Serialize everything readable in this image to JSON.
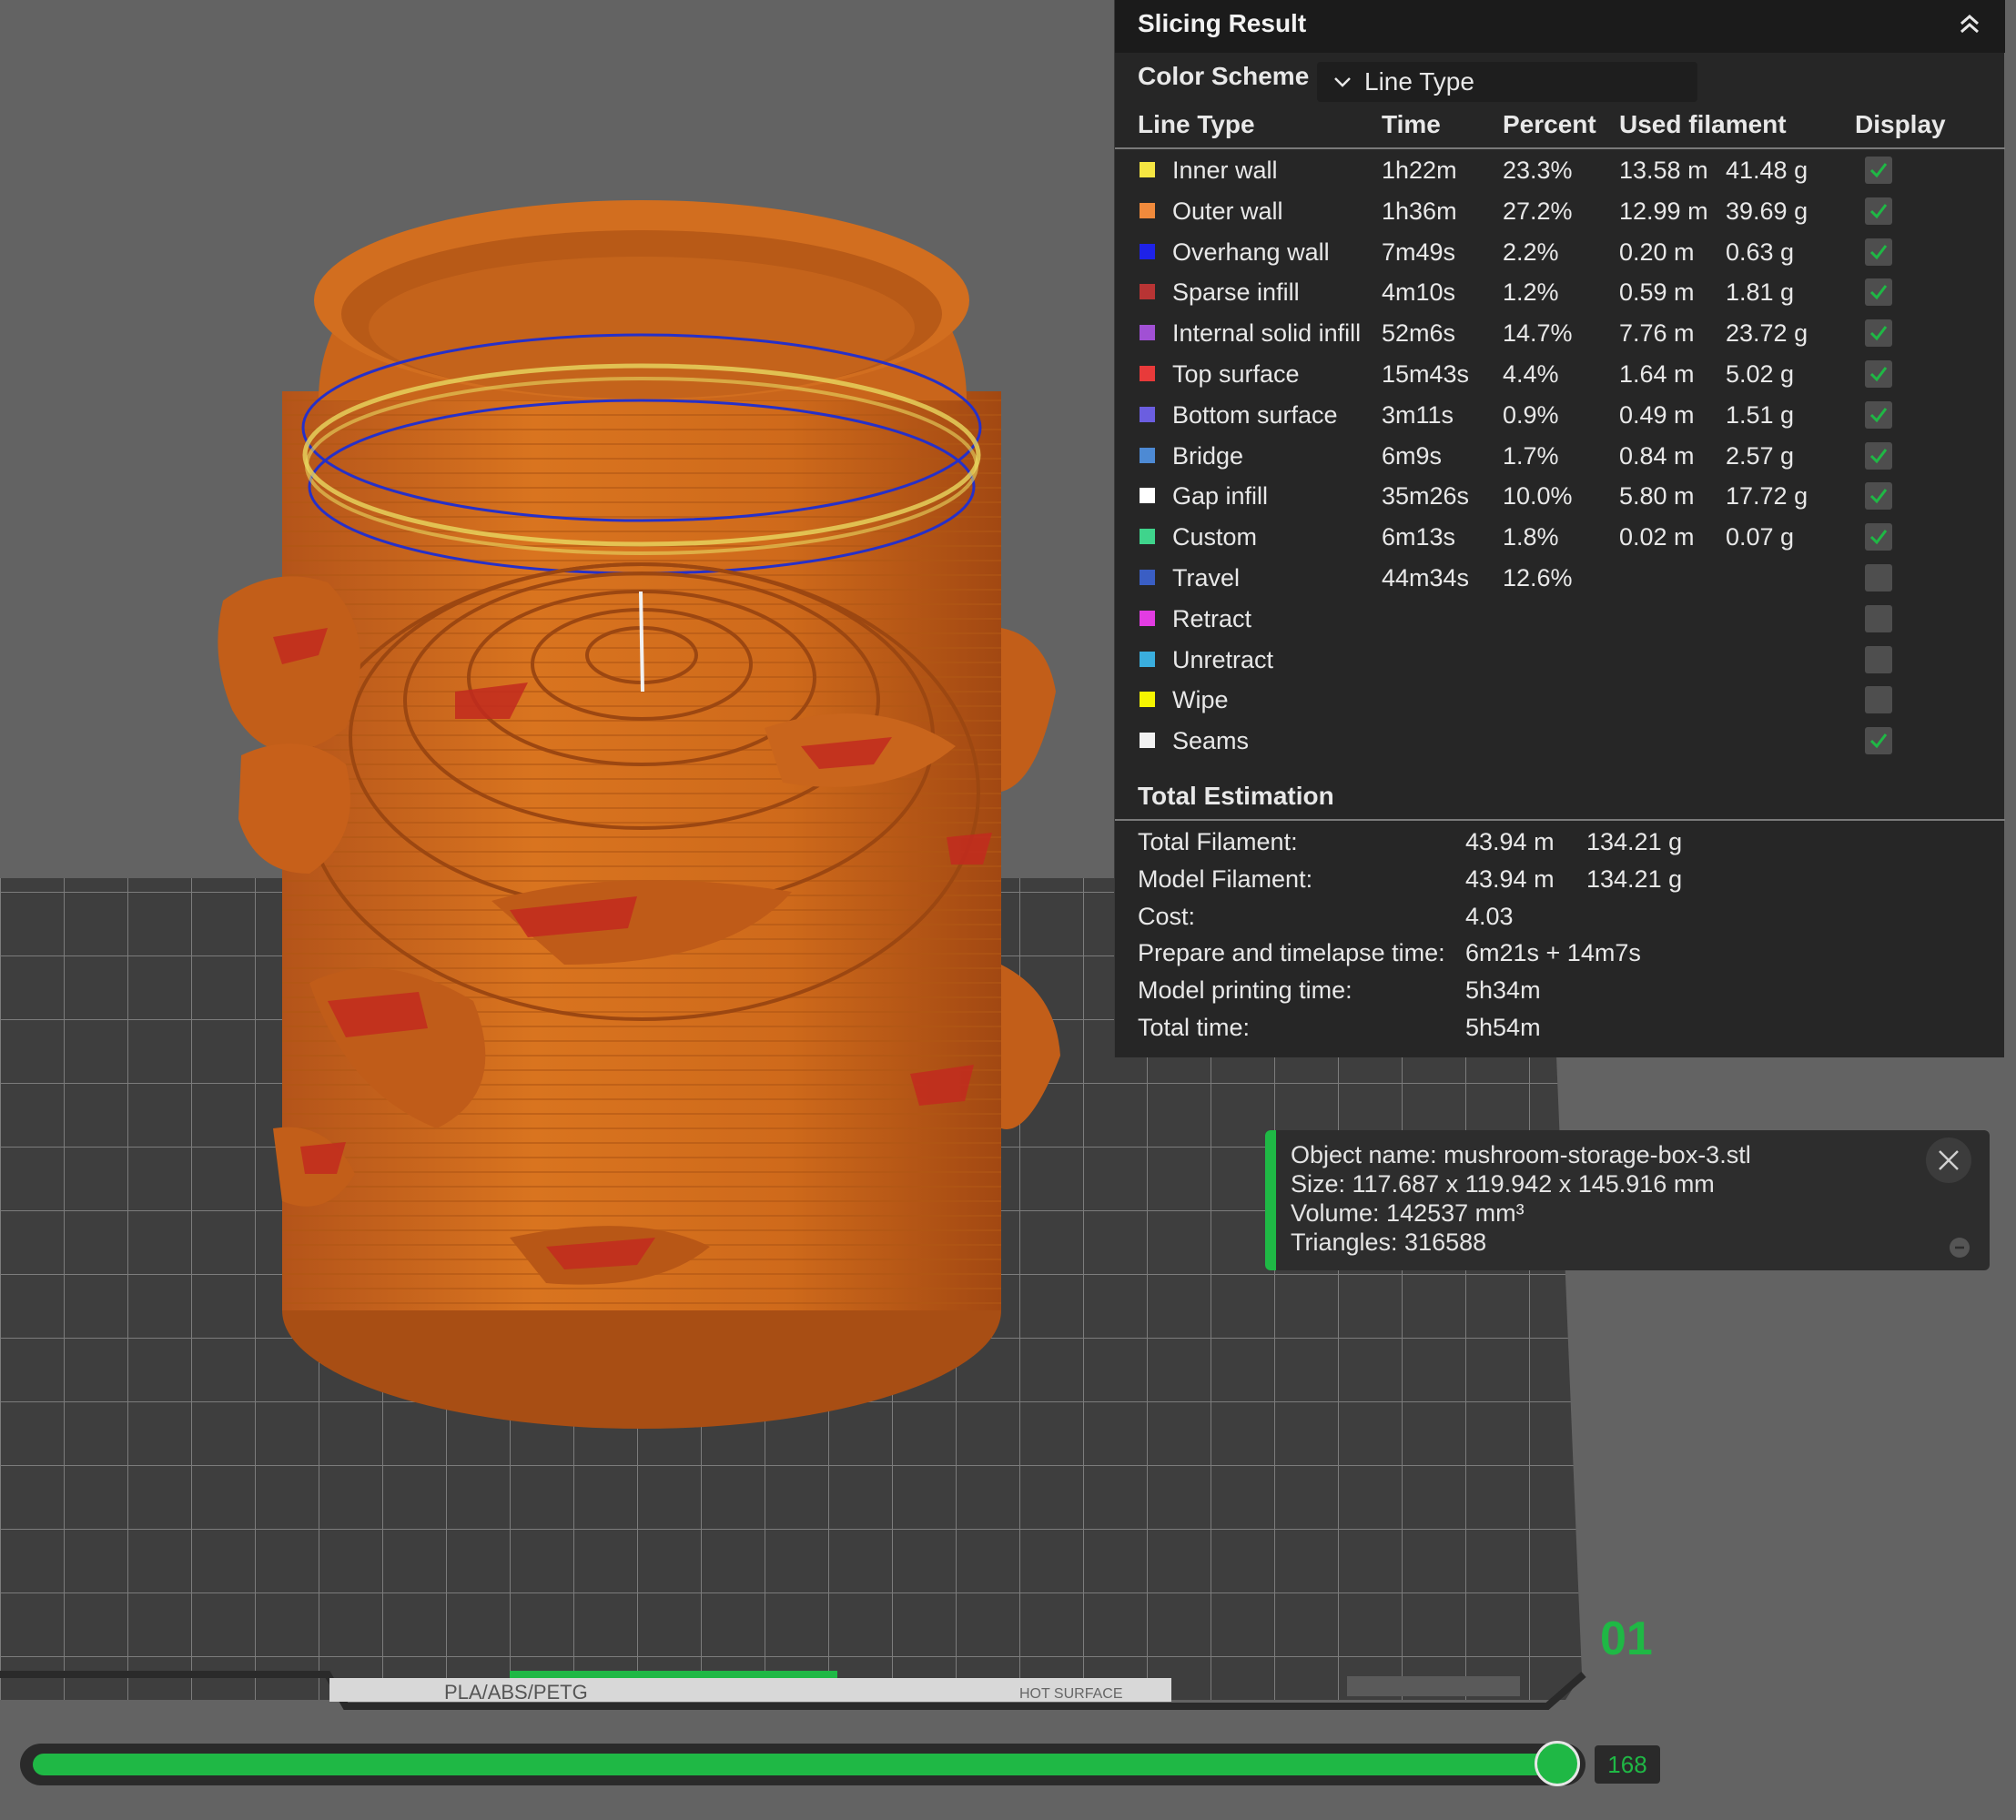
{
  "panel": {
    "title": "Slicing Result",
    "color_scheme_label": "Color Scheme",
    "color_scheme_value": "Line Type",
    "columns": {
      "line_type": "Line Type",
      "time": "Time",
      "percent": "Percent",
      "used_filament": "Used filament",
      "display": "Display"
    },
    "rows": [
      {
        "name": "Inner wall",
        "time": "1h22m",
        "percent": "23.3%",
        "length": "13.58 m",
        "weight": "41.48 g",
        "color": "#f5e642",
        "checked": true
      },
      {
        "name": "Outer wall",
        "time": "1h36m",
        "percent": "27.2%",
        "length": "12.99 m",
        "weight": "39.69 g",
        "color": "#f08a3c",
        "checked": true
      },
      {
        "name": "Overhang wall",
        "time": "7m49s",
        "percent": "2.2%",
        "length": "0.20 m",
        "weight": "0.63 g",
        "color": "#1e22e8",
        "checked": true
      },
      {
        "name": "Sparse infill",
        "time": "4m10s",
        "percent": "1.2%",
        "length": "0.59 m",
        "weight": "1.81 g",
        "color": "#b83434",
        "checked": true
      },
      {
        "name": "Internal solid infill",
        "time": "52m6s",
        "percent": "14.7%",
        "length": "7.76 m",
        "weight": "23.72 g",
        "color": "#a150d4",
        "checked": true
      },
      {
        "name": "Top surface",
        "time": "15m43s",
        "percent": "4.4%",
        "length": "1.64 m",
        "weight": "5.02 g",
        "color": "#e83a3a",
        "checked": true
      },
      {
        "name": "Bottom surface",
        "time": "3m11s",
        "percent": "0.9%",
        "length": "0.49 m",
        "weight": "1.51 g",
        "color": "#6b5ee0",
        "checked": true
      },
      {
        "name": "Bridge",
        "time": "6m9s",
        "percent": "1.7%",
        "length": "0.84 m",
        "weight": "2.57 g",
        "color": "#4d8ad4",
        "checked": true
      },
      {
        "name": "Gap infill",
        "time": "35m26s",
        "percent": "10.0%",
        "length": "5.80 m",
        "weight": "17.72 g",
        "color": "#ffffff",
        "checked": true
      },
      {
        "name": "Custom",
        "time": "6m13s",
        "percent": "1.8%",
        "length": "0.02 m",
        "weight": "0.07 g",
        "color": "#3fd48c",
        "checked": true
      },
      {
        "name": "Travel",
        "time": "44m34s",
        "percent": "12.6%",
        "length": "",
        "weight": "",
        "color": "#3a5ec4",
        "checked": false
      },
      {
        "name": "Retract",
        "time": "",
        "percent": "",
        "length": "",
        "weight": "",
        "color": "#e23ce2",
        "checked": false
      },
      {
        "name": "Unretract",
        "time": "",
        "percent": "",
        "length": "",
        "weight": "",
        "color": "#3aaede",
        "checked": false
      },
      {
        "name": "Wipe",
        "time": "",
        "percent": "",
        "length": "",
        "weight": "",
        "color": "#f5f500",
        "checked": false
      },
      {
        "name": "Seams",
        "time": "",
        "percent": "",
        "length": "",
        "weight": "",
        "color": "#f2f2f2",
        "checked": true
      }
    ],
    "total_title": "Total Estimation",
    "totals": [
      {
        "label": "Total Filament:",
        "value": "43.94 m",
        "value2": "134.21 g"
      },
      {
        "label": "Model Filament:",
        "value": "43.94 m",
        "value2": "134.21 g"
      },
      {
        "label": "Cost:",
        "value": "4.03",
        "value2": ""
      },
      {
        "label": "Prepare and timelapse time:",
        "value": "6m21s + 14m7s",
        "value2": ""
      },
      {
        "label": "Model printing time:",
        "value": "5h34m",
        "value2": ""
      },
      {
        "label": "Total time:",
        "value": "5h54m",
        "value2": ""
      }
    ]
  },
  "object_info": {
    "name_line": "Object name: mushroom-storage-box-3.stl",
    "size_line": "Size: 117.687 x 119.942 x 145.916 mm",
    "volume_line": "Volume: 142537 mm³",
    "triangles_line": "Triangles: 316588"
  },
  "bed": {
    "plate_number": "01",
    "plate_label": "PLA/ABS/PETG",
    "hot_label": "HOT SURFACE"
  },
  "layer_slider": {
    "value": "168",
    "fill_fraction": 0.99
  },
  "colors": {
    "accent_green": "#1fb845",
    "model_orange": "#d06a1c"
  },
  "icons": {
    "collapse": "double-chevron-up-icon",
    "dropdown": "chevron-down-icon",
    "check": "checkmark-icon",
    "close": "close-icon"
  }
}
